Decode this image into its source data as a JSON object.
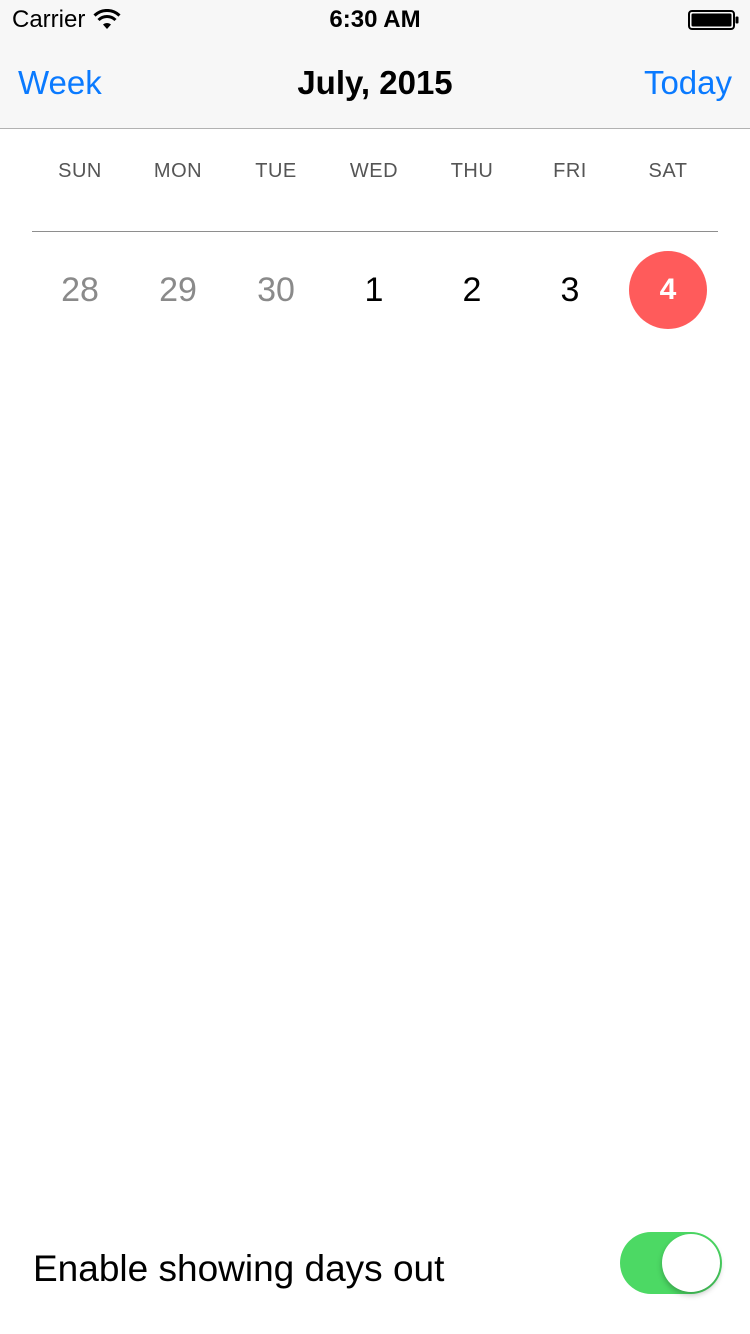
{
  "status_bar": {
    "carrier": "Carrier",
    "time": "6:30 AM",
    "wifi_icon": "wifi-icon",
    "battery_icon": "battery-icon"
  },
  "nav": {
    "left_label": "Week",
    "title": "July, 2015",
    "right_label": "Today",
    "accent_color": "#0a7aff"
  },
  "calendar": {
    "weekdays": [
      "SUN",
      "MON",
      "TUE",
      "WED",
      "THU",
      "FRI",
      "SAT"
    ],
    "days": [
      {
        "label": "28",
        "state": "out"
      },
      {
        "label": "29",
        "state": "out"
      },
      {
        "label": "30",
        "state": "out"
      },
      {
        "label": "1",
        "state": "in"
      },
      {
        "label": "2",
        "state": "in"
      },
      {
        "label": "3",
        "state": "in"
      },
      {
        "label": "4",
        "state": "selected"
      }
    ],
    "selected_color": "#ff5b5b"
  },
  "settings": {
    "toggle_label": "Enable showing days out",
    "toggle_on": true,
    "toggle_color": "#4cd964"
  }
}
